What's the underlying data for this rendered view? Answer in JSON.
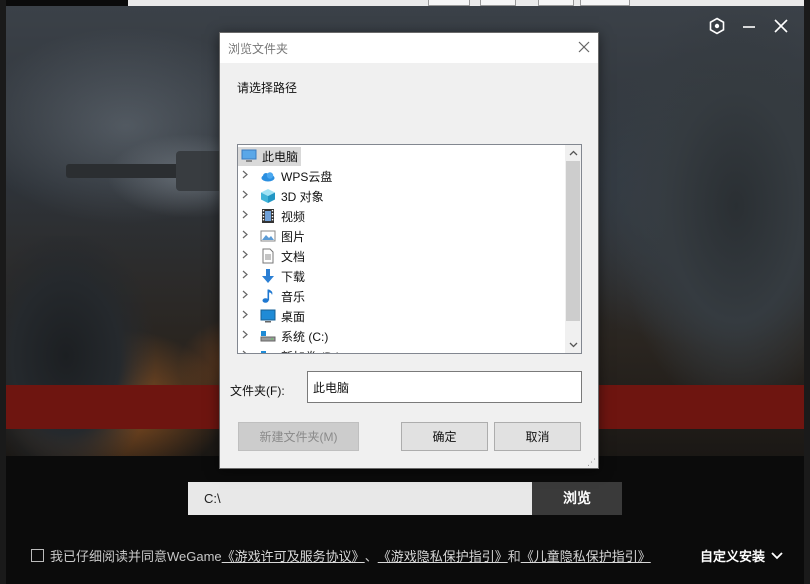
{
  "app": {
    "path_value": "C:\\",
    "browse_label": "浏览",
    "agree_prefix": "我已仔细阅读并同意WeGame",
    "agree_link1": "《游戏许可及服务协议》",
    "agree_sep1": "、",
    "agree_link2": "《游戏隐私保护指引》",
    "agree_sep2": "和",
    "agree_link3": "《儿童隐私保护指引》",
    "custom_install_label": "自定义安装"
  },
  "dialog": {
    "title": "浏览文件夹",
    "prompt": "请选择路径",
    "tree_root": "此电脑",
    "tree_items": [
      {
        "label": "WPS云盘",
        "icon": "cloud-icon"
      },
      {
        "label": "3D 对象",
        "icon": "cube-icon"
      },
      {
        "label": "视频",
        "icon": "film-icon"
      },
      {
        "label": "图片",
        "icon": "picture-icon"
      },
      {
        "label": "文档",
        "icon": "document-icon"
      },
      {
        "label": "下载",
        "icon": "download-arrow-icon"
      },
      {
        "label": "音乐",
        "icon": "music-note-icon"
      },
      {
        "label": "桌面",
        "icon": "desktop-icon"
      },
      {
        "label": "系统 (C:)",
        "icon": "drive-icon"
      },
      {
        "label": "新加卷 (D:)",
        "icon": "drive-icon"
      }
    ],
    "folder_label": "文件夹(F):",
    "folder_value": "此电脑",
    "new_folder_label": "新建文件夹(M)",
    "ok_label": "确定",
    "cancel_label": "取消"
  },
  "colors": {
    "accent_red": "#6e1510",
    "browse_bg": "#3a3a3a",
    "selection": "#d9d9d9"
  }
}
